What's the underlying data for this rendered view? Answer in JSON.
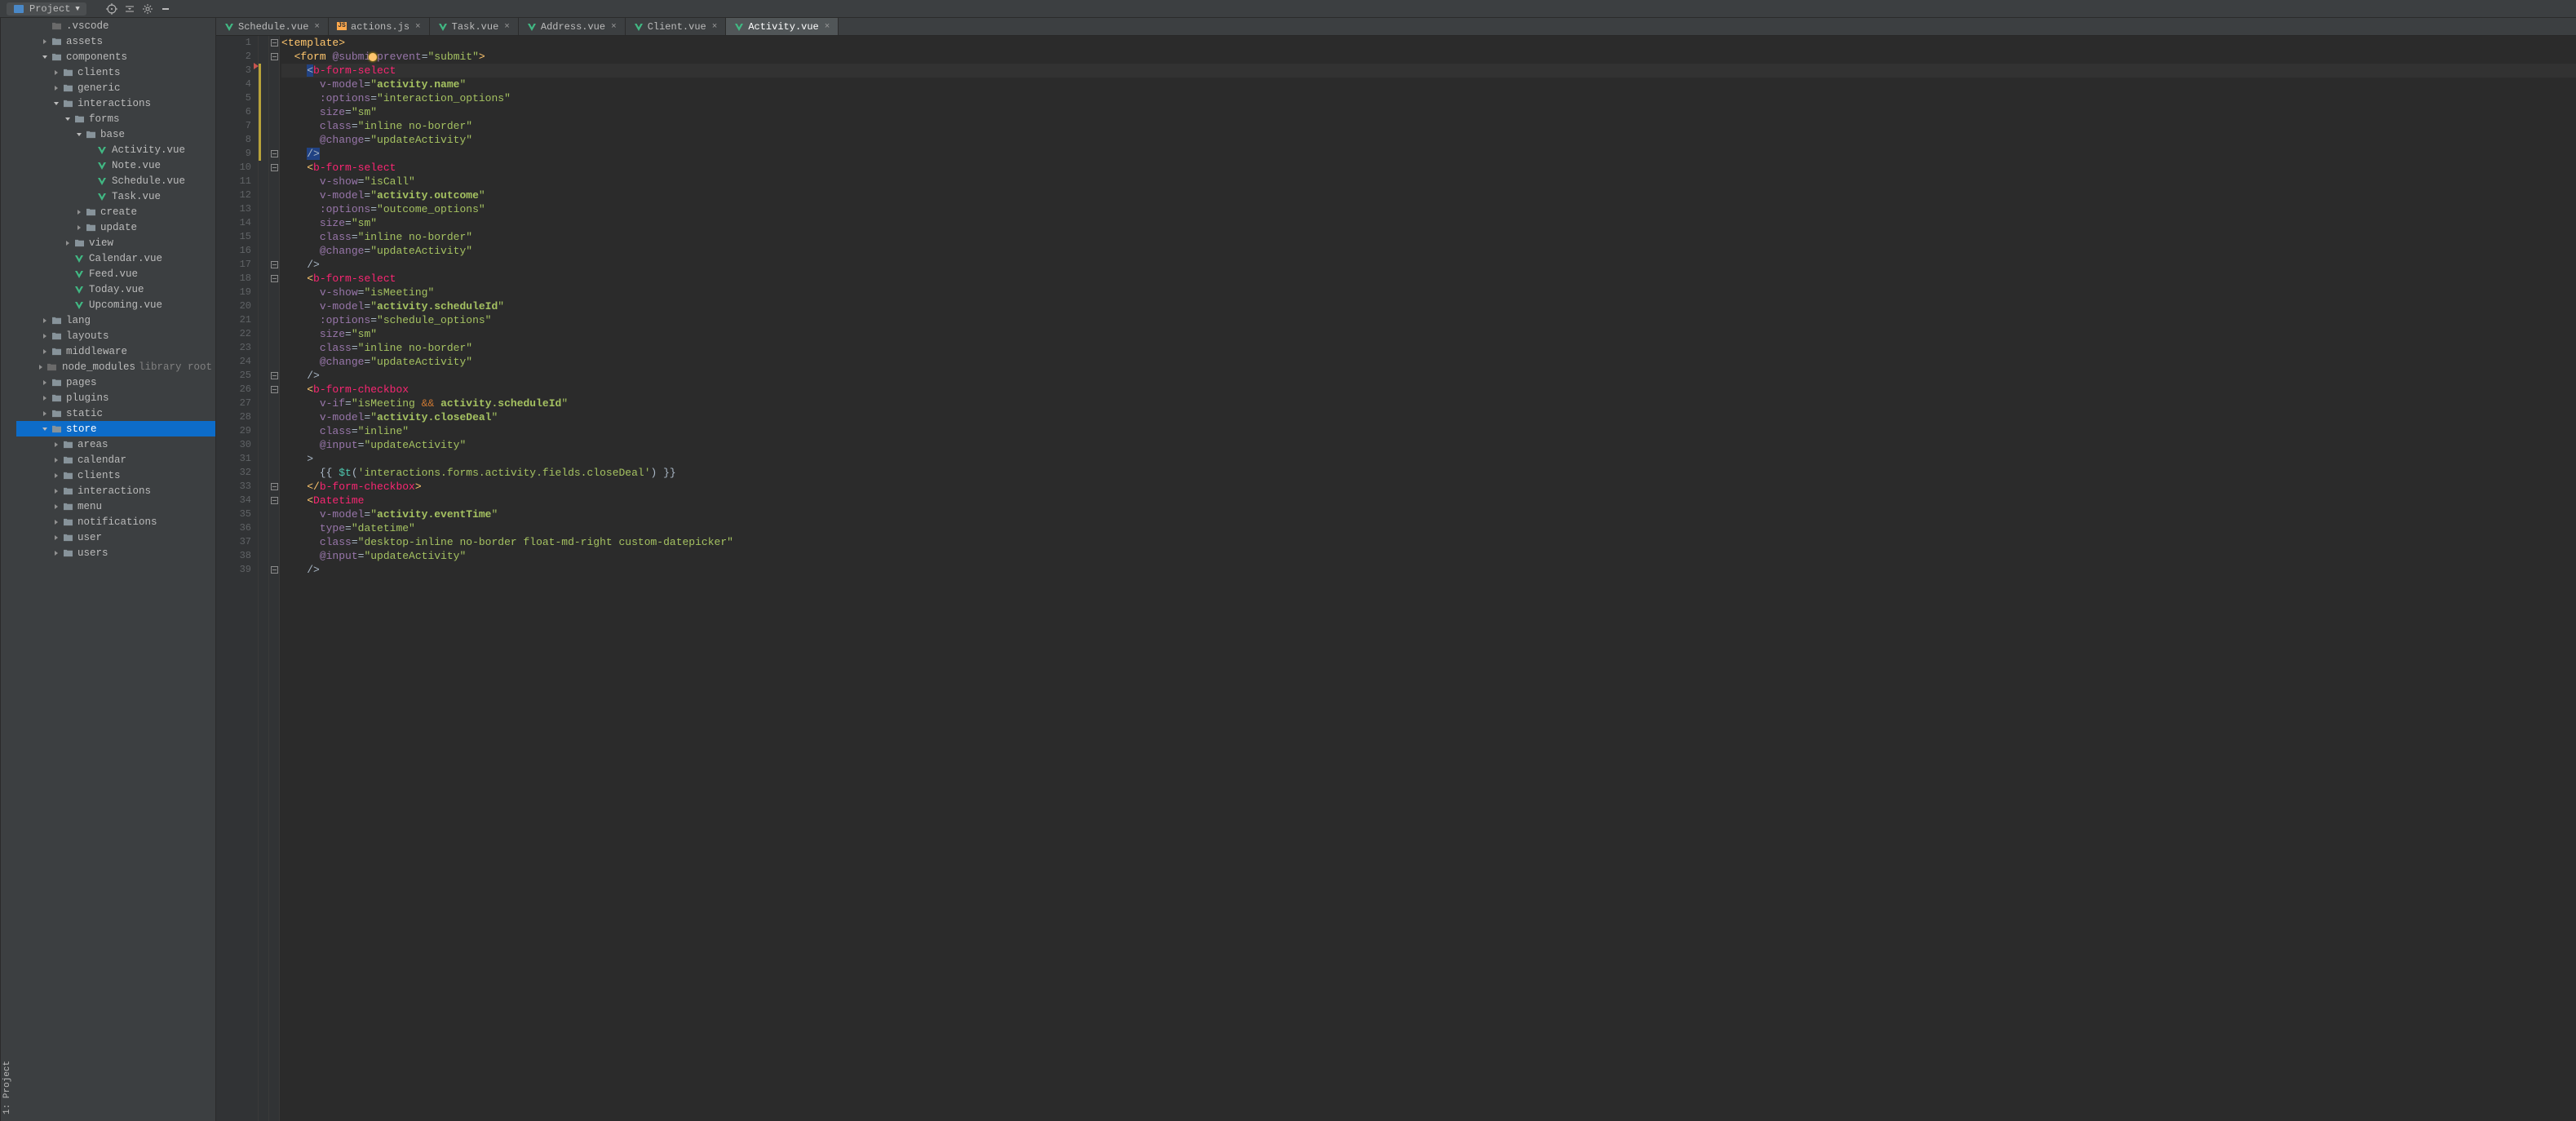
{
  "toolbar": {
    "project_label": "Project"
  },
  "left_bar": {
    "label": "1: Project"
  },
  "tabs": [
    {
      "name": "Schedule.vue",
      "type": "vue",
      "active": false
    },
    {
      "name": "actions.js",
      "type": "js",
      "active": false
    },
    {
      "name": "Task.vue",
      "type": "vue",
      "active": false
    },
    {
      "name": "Address.vue",
      "type": "vue",
      "active": false
    },
    {
      "name": "Client.vue",
      "type": "vue",
      "active": false
    },
    {
      "name": "Activity.vue",
      "type": "vue",
      "active": true
    }
  ],
  "tree": [
    {
      "depth": 1,
      "arrow": "",
      "icon": "folder-dark",
      "label": ".vscode"
    },
    {
      "depth": 1,
      "arrow": "right",
      "icon": "folder",
      "label": "assets"
    },
    {
      "depth": 1,
      "arrow": "down",
      "icon": "folder",
      "label": "components"
    },
    {
      "depth": 2,
      "arrow": "right",
      "icon": "folder",
      "label": "clients"
    },
    {
      "depth": 2,
      "arrow": "right",
      "icon": "folder",
      "label": "generic"
    },
    {
      "depth": 2,
      "arrow": "down",
      "icon": "folder",
      "label": "interactions"
    },
    {
      "depth": 3,
      "arrow": "down",
      "icon": "folder",
      "label": "forms"
    },
    {
      "depth": 4,
      "arrow": "down",
      "icon": "folder",
      "label": "base"
    },
    {
      "depth": 5,
      "arrow": "",
      "icon": "vue",
      "label": "Activity.vue"
    },
    {
      "depth": 5,
      "arrow": "",
      "icon": "vue",
      "label": "Note.vue"
    },
    {
      "depth": 5,
      "arrow": "",
      "icon": "vue",
      "label": "Schedule.vue"
    },
    {
      "depth": 5,
      "arrow": "",
      "icon": "vue",
      "label": "Task.vue"
    },
    {
      "depth": 4,
      "arrow": "right",
      "icon": "folder",
      "label": "create"
    },
    {
      "depth": 4,
      "arrow": "right",
      "icon": "folder",
      "label": "update"
    },
    {
      "depth": 3,
      "arrow": "right",
      "icon": "folder",
      "label": "view"
    },
    {
      "depth": 3,
      "arrow": "",
      "icon": "vue",
      "label": "Calendar.vue"
    },
    {
      "depth": 3,
      "arrow": "",
      "icon": "vue",
      "label": "Feed.vue"
    },
    {
      "depth": 3,
      "arrow": "",
      "icon": "vue",
      "label": "Today.vue"
    },
    {
      "depth": 3,
      "arrow": "",
      "icon": "vue",
      "label": "Upcoming.vue"
    },
    {
      "depth": 1,
      "arrow": "right",
      "icon": "folder",
      "label": "lang"
    },
    {
      "depth": 1,
      "arrow": "right",
      "icon": "folder",
      "label": "layouts"
    },
    {
      "depth": 1,
      "arrow": "right",
      "icon": "folder",
      "label": "middleware"
    },
    {
      "depth": 1,
      "arrow": "right",
      "icon": "folder-dark",
      "label": "node_modules",
      "suffix": "library root"
    },
    {
      "depth": 1,
      "arrow": "right",
      "icon": "folder",
      "label": "pages"
    },
    {
      "depth": 1,
      "arrow": "right",
      "icon": "folder",
      "label": "plugins"
    },
    {
      "depth": 1,
      "arrow": "right",
      "icon": "folder",
      "label": "static"
    },
    {
      "depth": 1,
      "arrow": "down",
      "icon": "folder",
      "label": "store",
      "selected": true
    },
    {
      "depth": 2,
      "arrow": "right",
      "icon": "folder",
      "label": "areas"
    },
    {
      "depth": 2,
      "arrow": "right",
      "icon": "folder",
      "label": "calendar"
    },
    {
      "depth": 2,
      "arrow": "right",
      "icon": "folder",
      "label": "clients"
    },
    {
      "depth": 2,
      "arrow": "right",
      "icon": "folder",
      "label": "interactions"
    },
    {
      "depth": 2,
      "arrow": "right",
      "icon": "folder",
      "label": "menu"
    },
    {
      "depth": 2,
      "arrow": "right",
      "icon": "folder",
      "label": "notifications"
    },
    {
      "depth": 2,
      "arrow": "right",
      "icon": "folder",
      "label": "user"
    },
    {
      "depth": 2,
      "arrow": "right",
      "icon": "folder",
      "label": "users"
    }
  ],
  "code": {
    "line_start": 1,
    "line_end": 39,
    "current_line": 3,
    "lines_html": [
      "<span class='t-angle'>&lt;</span><span class='t-tag'>template</span><span class='t-angle'>&gt;</span>",
      "  <span class='t-angle'>&lt;</span><span class='t-tag'>form</span> <span class='t-attr'>@submi</span><span style='position:relative'><span class='bulb' style='top:3px;left:-2px'></span></span><span class='t-attr'>.prevent</span>=<span class='t-str'>\"submit\"</span><span class='t-angle'>&gt;</span>",
      "    <span style='background:#214283'>&lt;</span><span class='t-comp2'>b-form-select</span>",
      "      <span class='t-attr'>v-model</span>=<span class='t-str'>\"</span><span class='t-str' style='font-weight:bold'>activity.name</span><span class='t-str'>\"</span>",
      "      <span class='t-attr'>:options</span>=<span class='t-str'>\"interaction_options\"</span>",
      "      <span class='t-attr'>size</span>=<span class='t-str'>\"sm\"</span>",
      "      <span class='t-attr'>class</span>=<span class='t-str'>\"inline no-border\"</span>",
      "      <span class='t-attr'>@change</span>=<span class='t-str'>\"updateActivity\"</span>",
      "    <span style='background:#214283'>/&gt;</span>",
      "    <span class='t-angle'>&lt;</span><span class='t-comp2'>b-form-select</span>",
      "      <span class='t-attr'>v-show</span>=<span class='t-str'>\"isCall\"</span>",
      "      <span class='t-attr'>v-model</span>=<span class='t-str'>\"</span><span class='t-str' style='font-weight:bold'>activity.outcome</span><span class='t-str'>\"</span>",
      "      <span class='t-attr'>:options</span>=<span class='t-str'>\"outcome_options\"</span>",
      "      <span class='t-attr'>size</span>=<span class='t-str'>\"sm\"</span>",
      "      <span class='t-attr'>class</span>=<span class='t-str'>\"inline no-border\"</span>",
      "      <span class='t-attr'>@change</span>=<span class='t-str'>\"updateActivity\"</span>",
      "    /&gt;",
      "    <span class='t-angle'>&lt;</span><span class='t-comp2'>b-form-select</span>",
      "      <span class='t-attr'>v-show</span>=<span class='t-str'>\"isMeeting\"</span>",
      "      <span class='t-attr'>v-model</span>=<span class='t-str'>\"</span><span class='t-str' style='font-weight:bold'>activity.scheduleId</span><span class='t-str'>\"</span>",
      "      <span class='t-attr'>:options</span>=<span class='t-str'>\"schedule_options\"</span>",
      "      <span class='t-attr'>size</span>=<span class='t-str'>\"sm\"</span>",
      "      <span class='t-attr'>class</span>=<span class='t-str'>\"inline no-border\"</span>",
      "      <span class='t-attr'>@change</span>=<span class='t-str'>\"updateActivity\"</span>",
      "    /&gt;",
      "    <span class='t-angle'>&lt;</span><span class='t-comp2'>b-form-checkbox</span>",
      "      <span class='t-attr'>v-if</span>=<span class='t-str'>\"isMeeting</span> <span style='color:#cc7832'>&amp;&amp;</span> <span class='t-str' style='font-weight:bold'>activity.scheduleId</span><span class='t-str'>\"</span>",
      "      <span class='t-attr'>v-model</span>=<span class='t-str'>\"</span><span class='t-str' style='font-weight:bold'>activity.closeDeal</span><span class='t-str'>\"</span>",
      "      <span class='t-attr'>class</span>=<span class='t-str'>\"inline\"</span>",
      "      <span class='t-attr'>@input</span>=<span class='t-str'>\"updateActivity\"</span>",
      "    &gt;",
      "      {{ <span class='t-fn'>$t</span>(<span class='t-str'>'interactions.forms.activity.fields.closeDeal'</span>) }}",
      "    <span class='t-angle'>&lt;/</span><span class='t-comp2'>b-form-checkbox</span><span class='t-angle'>&gt;</span>",
      "    <span class='t-angle'>&lt;</span><span class='t-comp2'>Datetime</span>",
      "      <span class='t-attr'>v-model</span>=<span class='t-str'>\"</span><span class='t-str' style='font-weight:bold'>activity.eventTime</span><span class='t-str'>\"</span>",
      "      <span class='t-attr'>type</span>=<span class='t-str'>\"datetime\"</span>",
      "      <span class='t-attr'>class</span>=<span class='t-str'>\"desktop-inline no-border float-md-right custom-datepicker\"</span>",
      "      <span class='t-attr'>@input</span>=<span class='t-str'>\"updateActivity\"</span>",
      "    /&gt;"
    ],
    "fold_marks": [
      1,
      2,
      9,
      10,
      17,
      18,
      25,
      26,
      33,
      34,
      39
    ],
    "yellow_border_start": 3,
    "yellow_border_end": 9
  }
}
